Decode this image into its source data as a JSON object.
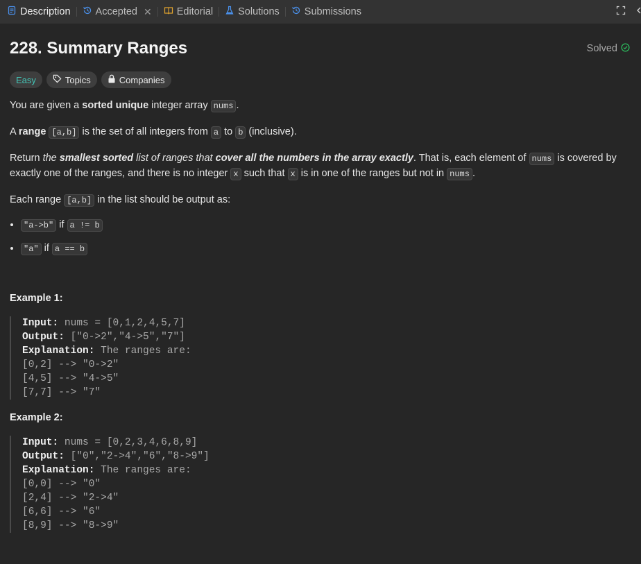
{
  "tabs": {
    "description": "Description",
    "accepted": "Accepted",
    "editorial": "Editorial",
    "solutions": "Solutions",
    "submissions": "Submissions"
  },
  "problem": {
    "title": "228. Summary Ranges",
    "status": "Solved",
    "difficulty": "Easy",
    "topics": "Topics",
    "companies": "Companies"
  },
  "desc": {
    "p1_a": "You are given a ",
    "p1_b": "sorted unique",
    "p1_c": " integer array ",
    "p1_code": "nums",
    "p1_d": ".",
    "p2_a": "A ",
    "p2_b": "range",
    "p2_code1": "[a,b]",
    "p2_c": " is the set of all integers from ",
    "p2_code2": "a",
    "p2_d": " to ",
    "p2_code3": "b",
    "p2_e": " (inclusive).",
    "p3_a": "Return ",
    "p3_b": "the ",
    "p3_c": "smallest sorted",
    "p3_d": " list of ranges that ",
    "p3_e": "cover all the numbers in the array exactly",
    "p3_f": ". That is, each element of ",
    "p3_code1": "nums",
    "p3_g": " is covered by exactly one of the ranges, and there is no integer ",
    "p3_code2": "x",
    "p3_h": " such that ",
    "p3_code3": "x",
    "p3_i": " is in one of the ranges but not in ",
    "p3_code4": "nums",
    "p3_j": ".",
    "p4_a": "Each range ",
    "p4_code": "[a,b]",
    "p4_b": " in the list should be output as:",
    "li1_code1": "\"a->b\"",
    "li1_mid": " if ",
    "li1_code2": "a != b",
    "li2_code1": "\"a\"",
    "li2_mid": " if ",
    "li2_code2": "a == b"
  },
  "examples": [
    {
      "title": "Example 1:",
      "input_label": "Input:",
      "input": " nums = [0,1,2,4,5,7]",
      "output_label": "Output:",
      "output": " [\"0->2\",\"4->5\",\"7\"]",
      "expl_label": "Explanation:",
      "expl": " The ranges are:",
      "lines": [
        "[0,2] --> \"0->2\"",
        "[4,5] --> \"4->5\"",
        "[7,7] --> \"7\""
      ]
    },
    {
      "title": "Example 2:",
      "input_label": "Input:",
      "input": " nums = [0,2,3,4,6,8,9]",
      "output_label": "Output:",
      "output": " [\"0\",\"2->4\",\"6\",\"8->9\"]",
      "expl_label": "Explanation:",
      "expl": " The ranges are:",
      "lines": [
        "[0,0] --> \"0\"",
        "[2,4] --> \"2->4\"",
        "[6,6] --> \"6\"",
        "[8,9] --> \"8->9\""
      ]
    }
  ],
  "colors": {
    "accent_blue": "#4a8fe8",
    "easy": "#44c4b6",
    "solved_green": "#2cbb5d",
    "bg": "#262626"
  },
  "icons": [
    "description-icon",
    "history-icon",
    "book-icon",
    "flask-icon",
    "fullscreen-icon",
    "check-circle-icon",
    "tag-icon",
    "lock-icon"
  ]
}
